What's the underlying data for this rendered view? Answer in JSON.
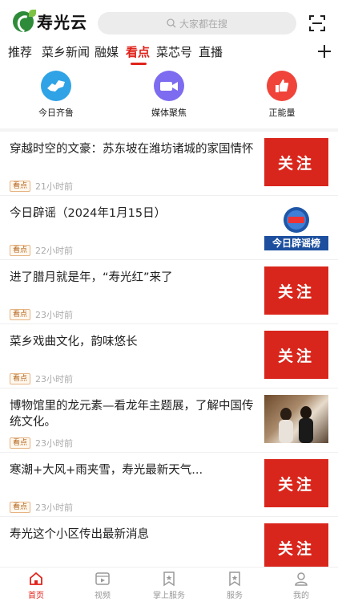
{
  "header": {
    "app_name": "寿光云",
    "search_placeholder": "大家都在搜",
    "logo_icon": "shouguang-cloud-logo",
    "scan_icon": "scan-icon"
  },
  "tabs": [
    {
      "label": "推荐"
    },
    {
      "label": "菜乡新闻"
    },
    {
      "label": "融媒"
    },
    {
      "label": "看点",
      "active": true
    },
    {
      "label": "菜芯号"
    },
    {
      "label": "直播"
    }
  ],
  "quick_entries": [
    {
      "label": "今日齐鲁",
      "icon": "shandong-map-icon",
      "color": "#2fa3e6"
    },
    {
      "label": "媒体聚焦",
      "icon": "camera-icon",
      "color": "#7d6cf0"
    },
    {
      "label": "正能量",
      "icon": "thumbs-up-icon",
      "color": "#f0443a"
    }
  ],
  "feed": [
    {
      "title": "穿越时空的文豪：苏东坡在潍坊诸城的家国情怀",
      "badge": "看点",
      "time": "21小时前",
      "thumb": "follow",
      "thumb_text": "关注"
    },
    {
      "title": "今日辟谣（2024年1月15日）",
      "badge": "看点",
      "time": "22小时前",
      "thumb": "rumor",
      "thumb_text": "今日辟谣榜"
    },
    {
      "title": "进了腊月就是年，“寿光红”来了",
      "badge": "看点",
      "time": "23小时前",
      "thumb": "follow",
      "thumb_text": "关注"
    },
    {
      "title": "菜乡戏曲文化，韵味悠长",
      "badge": "看点",
      "time": "23小时前",
      "thumb": "follow",
      "thumb_text": "关注"
    },
    {
      "title": "博物馆里的龙元素—看龙年主题展，了解中国传统文化。",
      "badge": "看点",
      "time": "23小时前",
      "thumb": "photo",
      "thumb_text": ""
    },
    {
      "title": "寒潮+大风+雨夹雪，寿光最新天气...",
      "badge": "看点",
      "time": "23小时前",
      "thumb": "follow",
      "thumb_text": "关注"
    },
    {
      "title": "寿光这个小区传出最新消息",
      "badge": "",
      "time": "",
      "thumb": "follow",
      "thumb_text": "关注"
    }
  ],
  "bottom_nav": [
    {
      "label": "首页",
      "icon": "home-icon",
      "active": true
    },
    {
      "label": "视频",
      "icon": "video-icon"
    },
    {
      "label": "掌上服务",
      "icon": "service-bookmark-icon"
    },
    {
      "label": "服务",
      "icon": "service-star-icon"
    },
    {
      "label": "我的",
      "icon": "profile-icon"
    }
  ],
  "colors": {
    "accent": "#e0231b",
    "follow_bg": "#d9261c",
    "brand_green": "#2e8b3a"
  }
}
